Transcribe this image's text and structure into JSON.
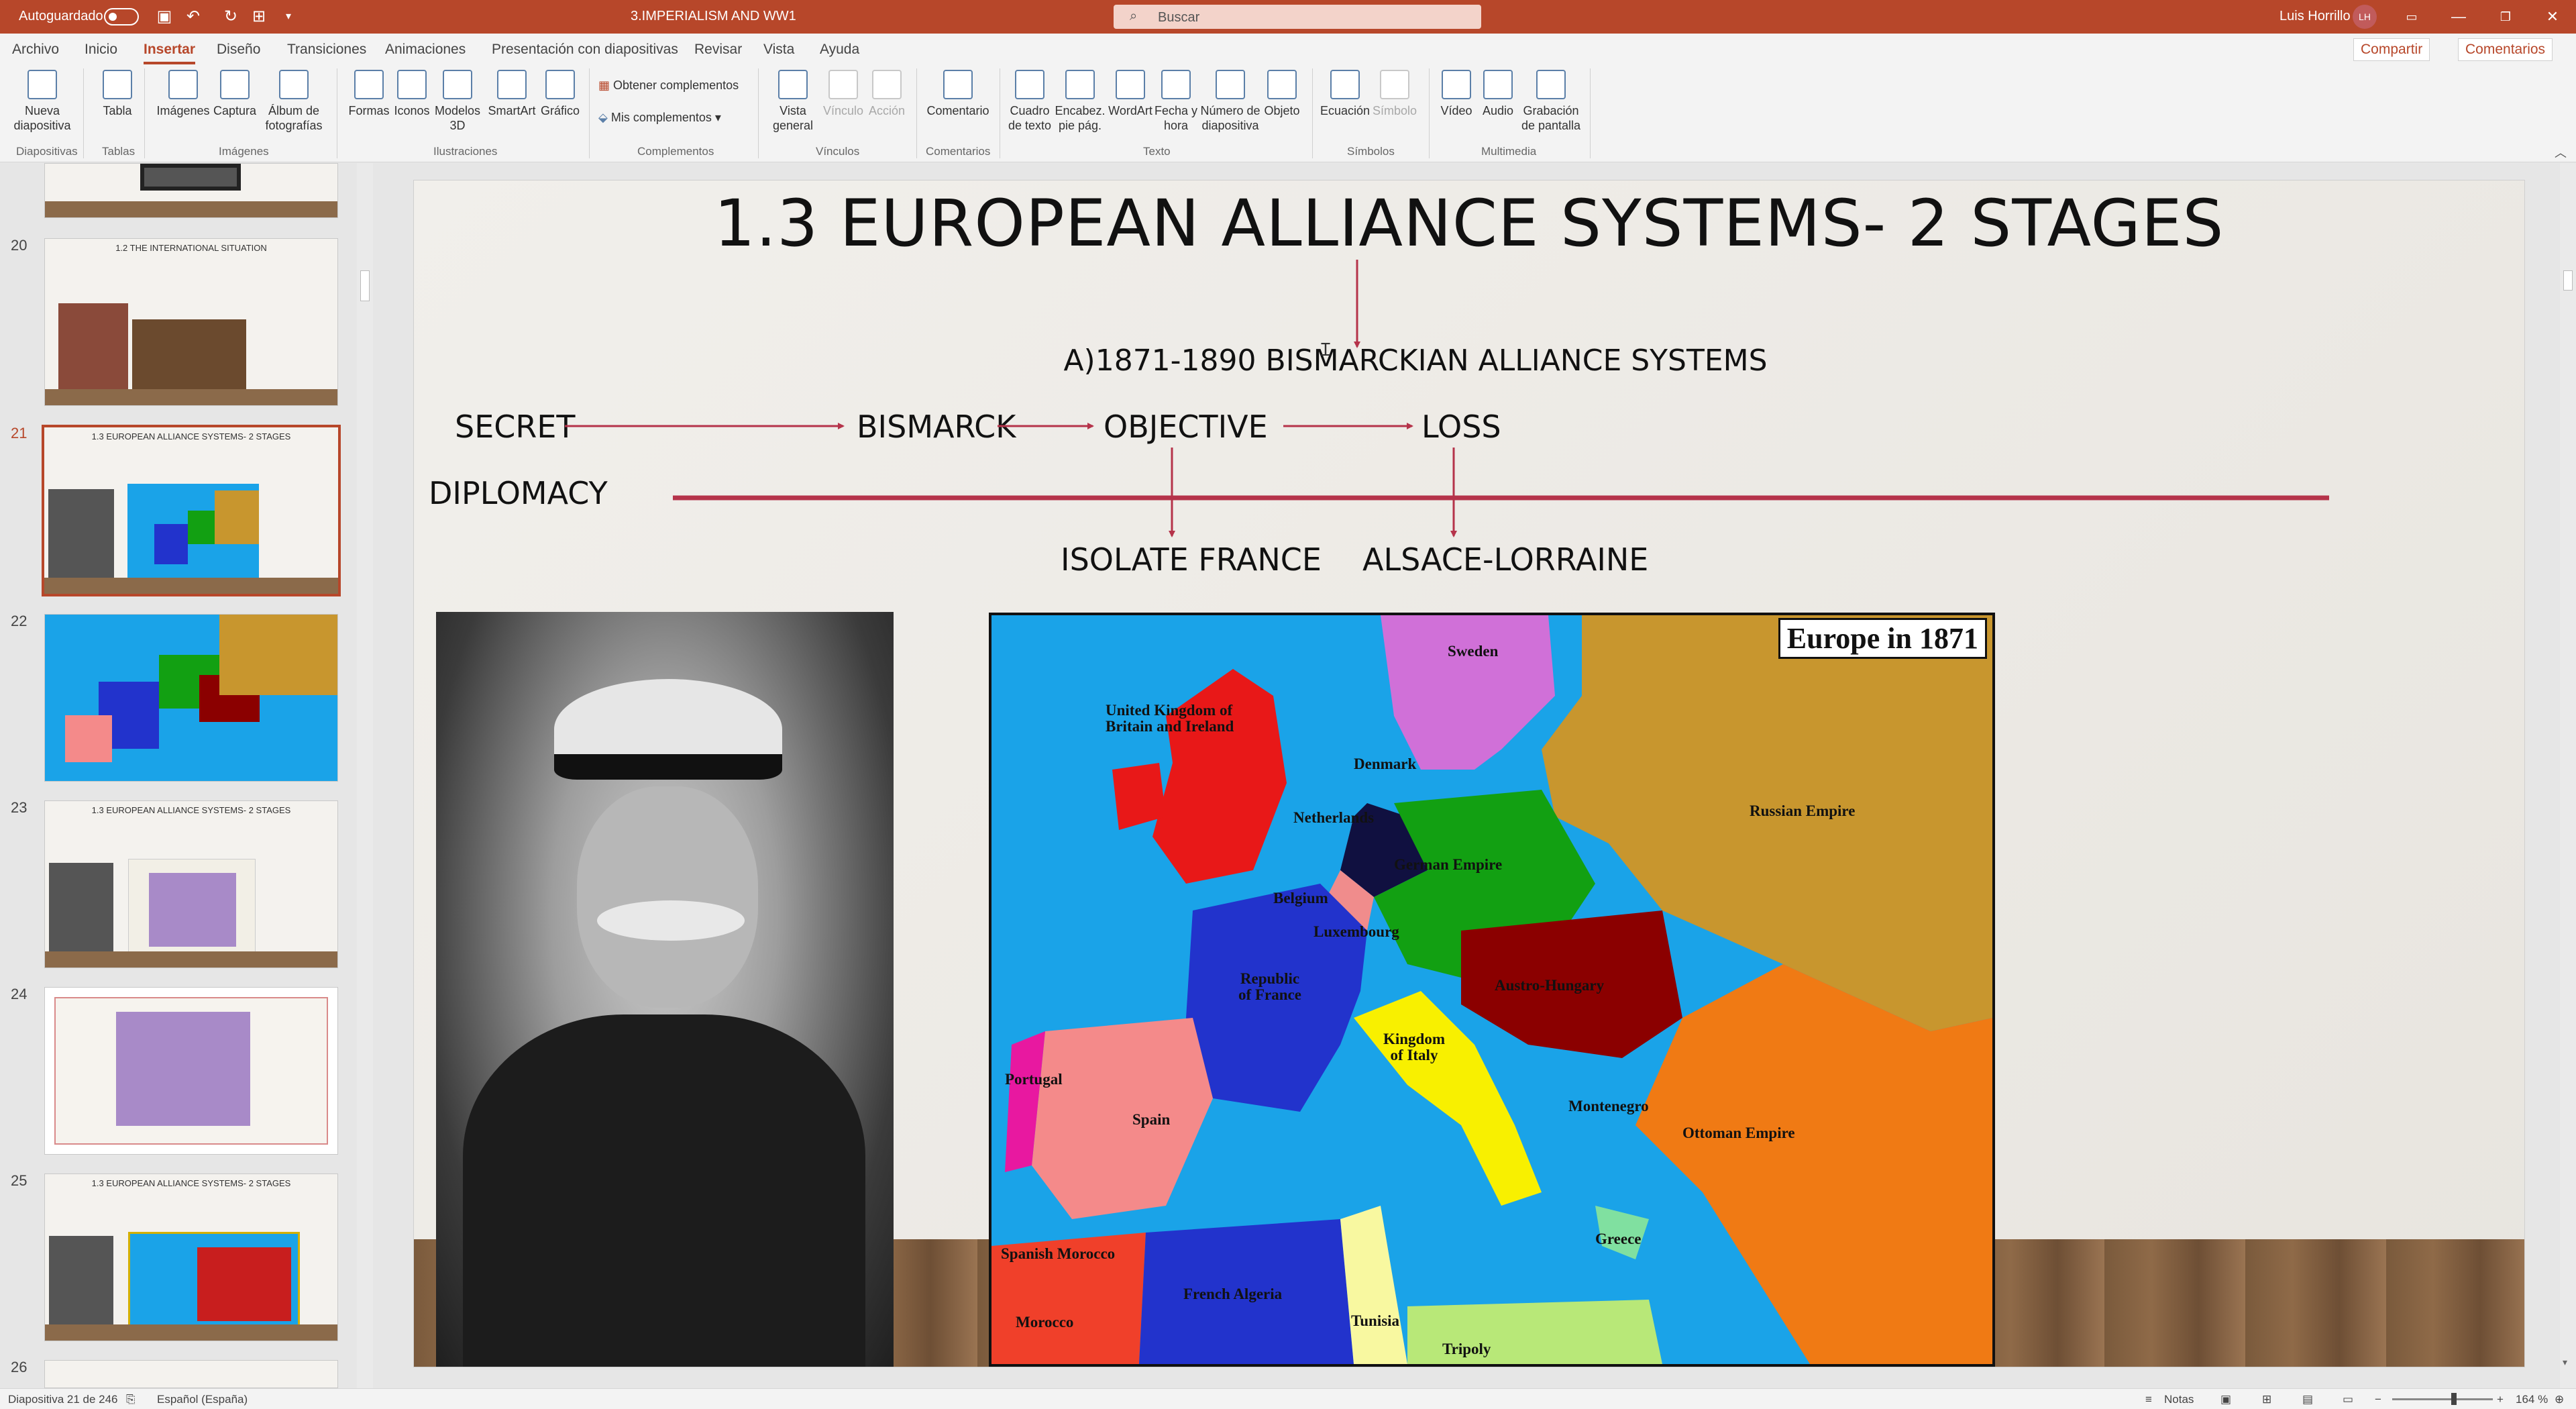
{
  "titlebar": {
    "autosave_label": "Autoguardado",
    "doc_title": "3.IMPERIALISM AND WW1",
    "search_placeholder": "Buscar",
    "user_name": "Luis Horrillo",
    "user_initials": "LH"
  },
  "tabs": [
    "Archivo",
    "Inicio",
    "Insertar",
    "Diseño",
    "Transiciones",
    "Animaciones",
    "Presentación con diapositivas",
    "Revisar",
    "Vista",
    "Ayuda"
  ],
  "active_tab": "Insertar",
  "top_right": {
    "share": "Compartir",
    "comments": "Comentarios"
  },
  "ribbon": {
    "buttons": {
      "nueva_diapositiva": "Nueva diapositiva",
      "tabla": "Tabla",
      "imagenes": "Imágenes",
      "captura": "Captura",
      "album": "Álbum de fotografías",
      "formas": "Formas",
      "iconos": "Iconos",
      "modelos3d": "Modelos 3D",
      "smartart": "SmartArt",
      "grafico": "Gráfico",
      "obtener_complementos": "Obtener complementos",
      "mis_complementos": "Mis complementos",
      "vista_general": "Vista general",
      "vinculo": "Vínculo",
      "accion": "Acción",
      "comentario": "Comentario",
      "cuadro_texto": "Cuadro de texto",
      "encabezado": "Encabez. pie pág.",
      "wordart": "WordArt",
      "fecha_hora": "Fecha y hora",
      "numero_diapositiva": "Número de diapositiva",
      "objeto": "Objeto",
      "ecuacion": "Ecuación",
      "simbolo": "Símbolo",
      "video": "Vídeo",
      "audio": "Audio",
      "grabacion": "Grabación de pantalla"
    },
    "groups": {
      "diapositivas": "Diapositivas",
      "tablas": "Tablas",
      "imagenes": "Imágenes",
      "ilustraciones": "Ilustraciones",
      "complementos": "Complementos",
      "vinculos": "Vínculos",
      "comentarios": "Comentarios",
      "texto": "Texto",
      "simbolos": "Símbolos",
      "multimedia": "Multimedia"
    }
  },
  "thumbnails": {
    "items": [
      {
        "num": "20",
        "title": "1.2 THE INTERNATIONAL SITUATION"
      },
      {
        "num": "21",
        "title": "1.3 EUROPEAN ALLIANCE SYSTEMS- 2 STAGES"
      },
      {
        "num": "22",
        "title": ""
      },
      {
        "num": "23",
        "title": "1.3 EUROPEAN ALLIANCE SYSTEMS- 2 STAGES"
      },
      {
        "num": "24",
        "title": ""
      },
      {
        "num": "25",
        "title": "1.3 EUROPEAN ALLIANCE SYSTEMS- 2 STAGES"
      },
      {
        "num": "26",
        "title": ""
      }
    ]
  },
  "slide": {
    "title": "1.3 EUROPEAN ALLIANCE SYSTEMS- 2 STAGES",
    "subtitle": "A)1871-1890 BISMARCKIAN ALLIANCE SYSTEMS",
    "secret": "SECRET",
    "diplomacy": "DIPLOMACY",
    "bismarck": "BISMARCK",
    "objective": "OBJECTIVE",
    "loss": "LOSS",
    "isolate_france": "ISOLATE FRANCE",
    "alsace_lorraine": "ALSACE-LORRAINE",
    "map_title": "Europe in 1871",
    "map_labels": {
      "sweden": "Sweden",
      "uk": "United Kingdom of Britain and Ireland",
      "denmark": "Denmark",
      "netherlands": "Netherlands",
      "german_empire": "German Empire",
      "russian_empire": "Russian Empire",
      "belgium": "Belgium",
      "luxembourg": "Luxembourg",
      "france": "Republic of France",
      "austria_hungary": "Austro-Hungary",
      "italy": "Kingdom of Italy",
      "portugal": "Portugal",
      "spain": "Spain",
      "montenegro": "Montenegro",
      "ottoman": "Ottoman Empire",
      "greece": "Greece",
      "spanish_morocco": "Spanish Morocco",
      "morocco": "Morocco",
      "french_algeria": "French Algeria",
      "tunisia": "Tunisia",
      "tripoly": "Tripoly"
    }
  },
  "status": {
    "slide_counter": "Diapositiva 21 de 246",
    "language": "Español (España)",
    "notes": "Notas",
    "zoom": "164 %"
  },
  "colors": {
    "accent": "#b7472a",
    "arrow": "#b5334a",
    "sea": "#1aa3e8"
  }
}
